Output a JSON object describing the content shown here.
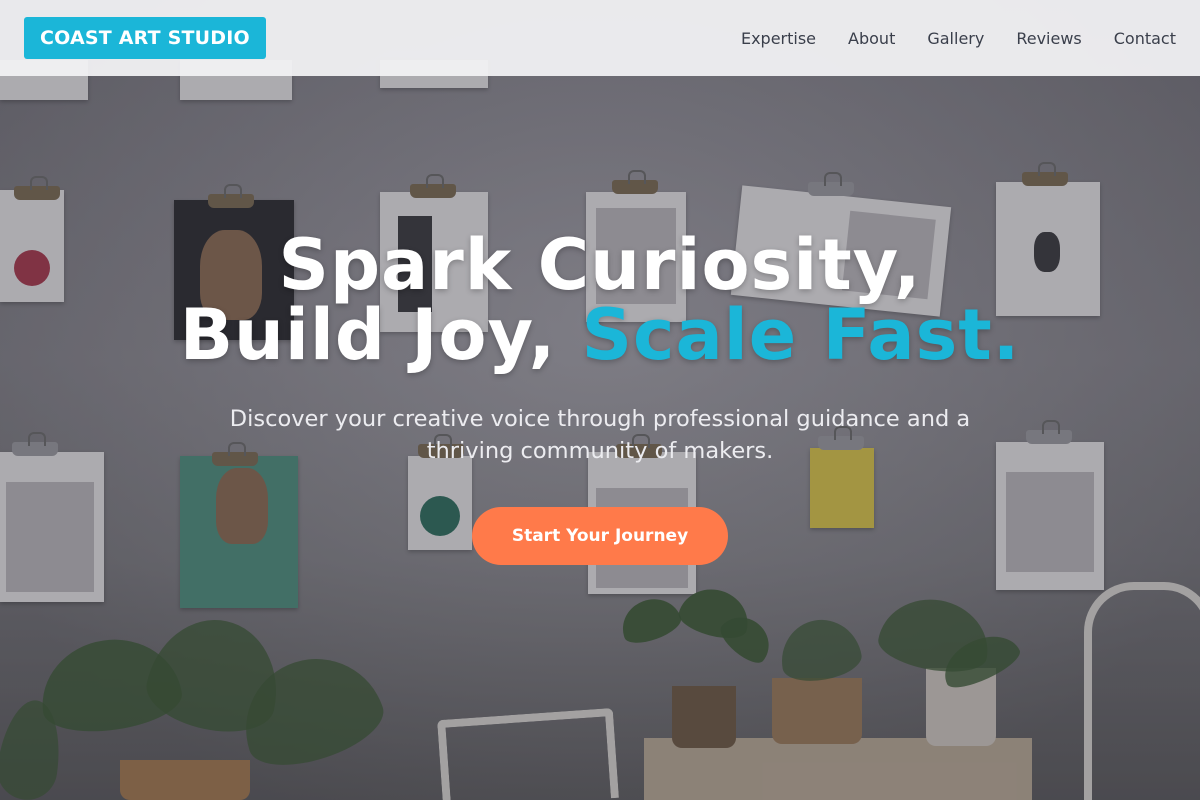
{
  "brand": {
    "name": "COAST ART STUDIO",
    "color": "#1bb6d8"
  },
  "nav": {
    "items": [
      {
        "label": "Expertise"
      },
      {
        "label": "About"
      },
      {
        "label": "Gallery"
      },
      {
        "label": "Reviews"
      },
      {
        "label": "Contact"
      }
    ]
  },
  "hero": {
    "headline_line1": "Spark Curiosity,",
    "headline_line2_plain": "Build Joy, ",
    "headline_line2_accent": "Scale Fast.",
    "subtitle": "Discover your creative voice through professional guidance and a thriving community of makers.",
    "cta_label": "Start Your Journey",
    "accent_color": "#1bb6d8",
    "cta_color": "#ff7a4a"
  }
}
